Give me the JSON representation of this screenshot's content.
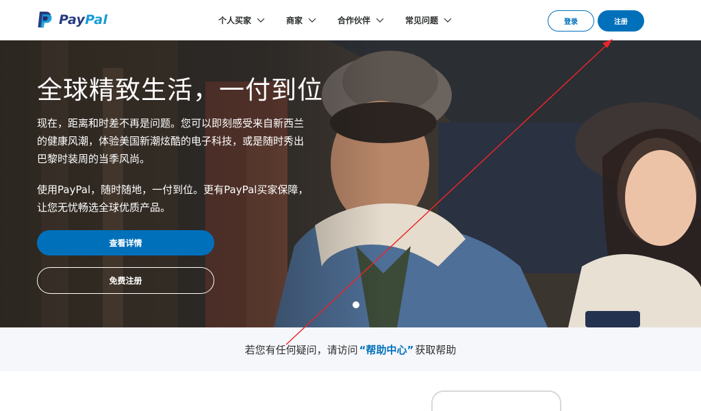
{
  "header": {
    "logo": {
      "pay": "Pay",
      "pal": "Pal"
    },
    "nav": [
      {
        "label": "个人买家"
      },
      {
        "label": "商家"
      },
      {
        "label": "合作伙伴"
      },
      {
        "label": "常见问题"
      }
    ],
    "login_label": "登录",
    "signup_label": "注册"
  },
  "hero": {
    "title": "全球精致生活，一付到位",
    "paragraph1": "现在，距离和时差不再是问题。您可以即刻感受来自新西兰的健康风潮，体验美国新潮炫酷的电子科技，或是随时秀出巴黎时装周的当季风尚。",
    "paragraph2": "使用PayPal，随时随地，一付到位。更有PayPal买家保障，让您无忧畅选全球优质产品。",
    "details_button": "查看详情",
    "free_signup_button": "免费注册"
  },
  "help": {
    "prefix": "若您有任何疑问，请访问",
    "link": "“帮助中心”",
    "suffix": "获取帮助"
  },
  "colors": {
    "primary": "#0070ba",
    "text": "#2c2e2f",
    "annotation": "#e8262a"
  }
}
